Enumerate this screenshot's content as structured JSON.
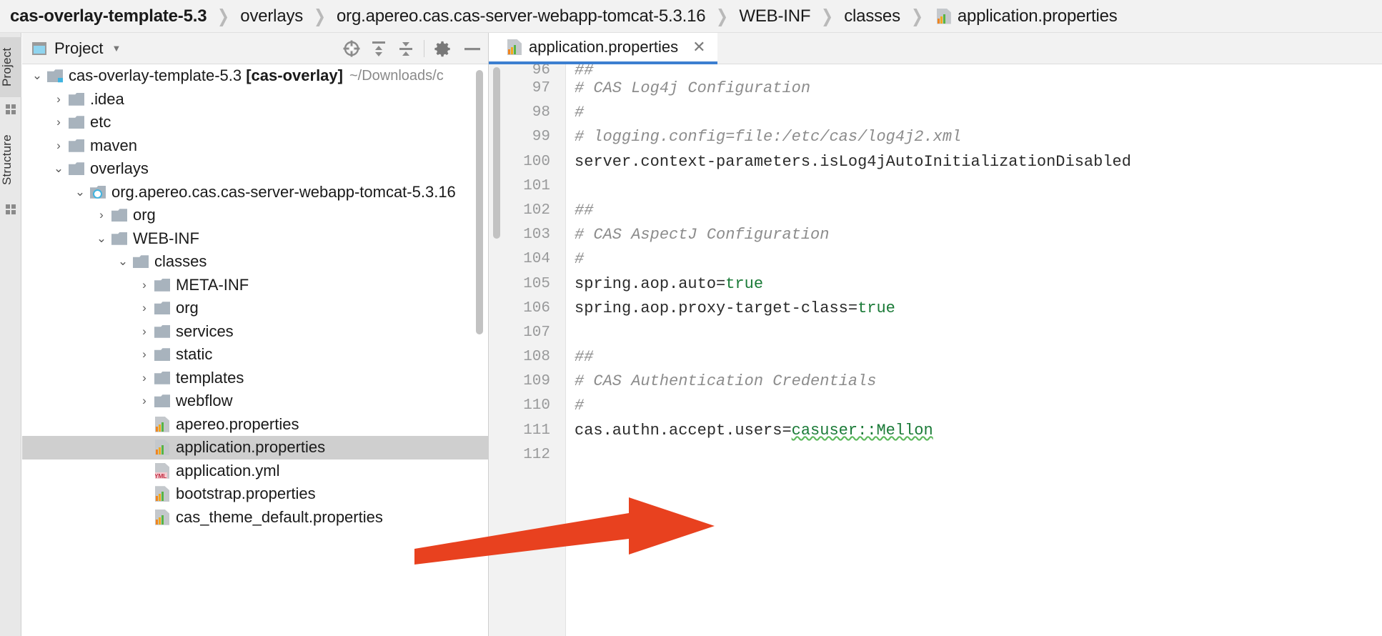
{
  "breadcrumb": {
    "separator": "❯",
    "items": [
      {
        "label": "cas-overlay-template-5.3",
        "icon": null
      },
      {
        "label": "overlays",
        "icon": null
      },
      {
        "label": "org.apereo.cas.cas-server-webapp-tomcat-5.3.16",
        "icon": null
      },
      {
        "label": "WEB-INF",
        "icon": null
      },
      {
        "label": "classes",
        "icon": null
      },
      {
        "label": "application.properties",
        "icon": "properties-file-icon"
      }
    ]
  },
  "toolstrip": {
    "project_label": "Project",
    "structure_label": "Structure"
  },
  "project_panel": {
    "title": "Project",
    "caret": "▼",
    "tools": [
      {
        "name": "locate-target-icon"
      },
      {
        "name": "expand-all-icon"
      },
      {
        "name": "collapse-all-icon"
      },
      {
        "name": "gear-icon"
      },
      {
        "name": "hide-icon"
      }
    ]
  },
  "tree": [
    {
      "indent": 0,
      "arrow": "⌄",
      "icon": "folder-module",
      "label": "cas-overlay-template-5.3",
      "bold_suffix": "[cas-overlay]",
      "path": "~/Downloads/c",
      "selected": false
    },
    {
      "indent": 1,
      "arrow": "›",
      "icon": "folder",
      "label": ".idea",
      "selected": false
    },
    {
      "indent": 1,
      "arrow": "›",
      "icon": "folder",
      "label": "etc",
      "selected": false
    },
    {
      "indent": 1,
      "arrow": "›",
      "icon": "folder",
      "label": "maven",
      "selected": false
    },
    {
      "indent": 1,
      "arrow": "⌄",
      "icon": "folder",
      "label": "overlays",
      "selected": false
    },
    {
      "indent": 2,
      "arrow": "⌄",
      "icon": "folder-library",
      "label": "org.apereo.cas.cas-server-webapp-tomcat-5.3.16",
      "selected": false
    },
    {
      "indent": 3,
      "arrow": "›",
      "icon": "folder",
      "label": "org",
      "selected": false
    },
    {
      "indent": 3,
      "arrow": "⌄",
      "icon": "folder",
      "label": "WEB-INF",
      "selected": false
    },
    {
      "indent": 4,
      "arrow": "⌄",
      "icon": "folder",
      "label": "classes",
      "selected": false
    },
    {
      "indent": 5,
      "arrow": "›",
      "icon": "folder",
      "label": "META-INF",
      "selected": false
    },
    {
      "indent": 5,
      "arrow": "›",
      "icon": "folder",
      "label": "org",
      "selected": false
    },
    {
      "indent": 5,
      "arrow": "›",
      "icon": "folder",
      "label": "services",
      "selected": false
    },
    {
      "indent": 5,
      "arrow": "›",
      "icon": "folder",
      "label": "static",
      "selected": false
    },
    {
      "indent": 5,
      "arrow": "›",
      "icon": "folder",
      "label": "templates",
      "selected": false
    },
    {
      "indent": 5,
      "arrow": "›",
      "icon": "folder",
      "label": "webflow",
      "selected": false
    },
    {
      "indent": 5,
      "arrow": "",
      "icon": "properties-file",
      "label": "apereo.properties",
      "selected": false
    },
    {
      "indent": 5,
      "arrow": "",
      "icon": "properties-file",
      "label": "application.properties",
      "selected": true
    },
    {
      "indent": 5,
      "arrow": "",
      "icon": "yml-file",
      "label": "application.yml",
      "selected": false
    },
    {
      "indent": 5,
      "arrow": "",
      "icon": "properties-file",
      "label": "bootstrap.properties",
      "selected": false
    },
    {
      "indent": 5,
      "arrow": "",
      "icon": "properties-file",
      "label": "cas_theme_default.properties",
      "selected": false
    }
  ],
  "editor": {
    "tab": {
      "label": "application.properties",
      "close": "✕",
      "icon": "properties-file-icon"
    },
    "accent_color": "#3c7fd0",
    "lines": [
      {
        "num": "96",
        "text": "##",
        "kind": "comment"
      },
      {
        "num": "97",
        "text": "# CAS Log4j Configuration",
        "kind": "comment"
      },
      {
        "num": "98",
        "text": "#",
        "kind": "comment"
      },
      {
        "num": "99",
        "text": "# logging.config=file:/etc/cas/log4j2.xml",
        "kind": "comment"
      },
      {
        "num": "100",
        "text": "server.context-parameters.isLog4jAutoInitializationDisabled",
        "kind": "code"
      },
      {
        "num": "101",
        "text": "",
        "kind": "code"
      },
      {
        "num": "102",
        "text": "##",
        "kind": "comment"
      },
      {
        "num": "103",
        "text": "# CAS AspectJ Configuration",
        "kind": "comment"
      },
      {
        "num": "104",
        "text": "#",
        "kind": "comment"
      },
      {
        "num": "105",
        "text": "spring.aop.auto=",
        "value": "true",
        "kind": "code"
      },
      {
        "num": "106",
        "text": "spring.aop.proxy-target-class=",
        "value": "true",
        "kind": "code"
      },
      {
        "num": "107",
        "text": "",
        "kind": "code"
      },
      {
        "num": "108",
        "text": "##",
        "kind": "comment"
      },
      {
        "num": "109",
        "text": "# CAS Authentication Credentials",
        "kind": "comment"
      },
      {
        "num": "110",
        "text": "#",
        "kind": "comment"
      },
      {
        "num": "111",
        "text": "cas.authn.accept.users=",
        "value": "casuser::Mellon",
        "value_squiggle": true,
        "kind": "code"
      },
      {
        "num": "112",
        "text": "",
        "kind": "code"
      }
    ]
  },
  "annotation": {
    "arrow_color": "#e8411f",
    "name": "red-pointer-arrow"
  }
}
